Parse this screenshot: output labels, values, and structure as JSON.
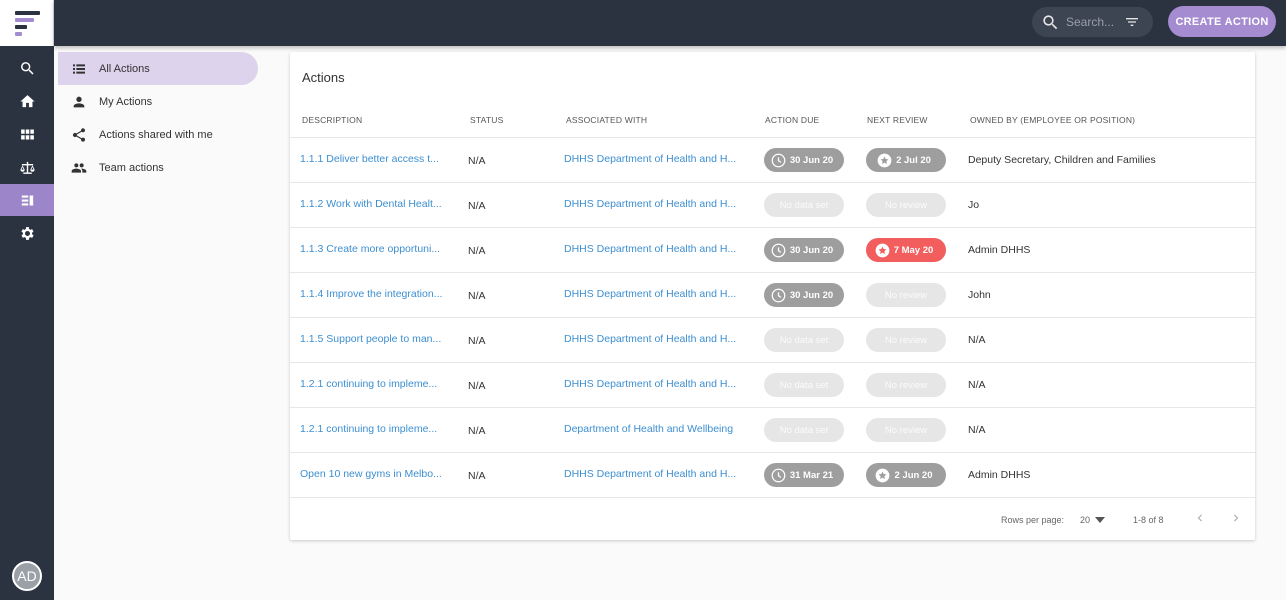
{
  "topbar": {
    "search_placeholder": "Search...",
    "create_label": "CREATE ACTION"
  },
  "rail": {
    "avatar_initials": "AD",
    "items": [
      "search-icon",
      "home-icon",
      "dashboard-icon",
      "balance-scale-icon",
      "actions-icon",
      "settings-icon"
    ],
    "active_index": 4
  },
  "subnav": {
    "items": [
      {
        "label": "All Actions",
        "icon": "list-icon",
        "active": true
      },
      {
        "label": "My Actions",
        "icon": "person-icon",
        "active": false
      },
      {
        "label": "Actions shared with me",
        "icon": "share-icon",
        "active": false
      },
      {
        "label": "Team actions",
        "icon": "people-icon",
        "active": false
      }
    ]
  },
  "table": {
    "title": "Actions",
    "columns": [
      "DESCRIPTION",
      "STATUS",
      "ASSOCIATED WITH",
      "ACTION DUE",
      "NEXT REVIEW",
      "OWNED BY (EMPLOYEE OR POSITION)"
    ],
    "rows": [
      {
        "description": "1.1.1 Deliver better access t...",
        "status": "N/A",
        "associated": "DHHS Department of Health and H...",
        "due": "30 Jun 20",
        "due_state": "set",
        "review": "2 Jul 20",
        "review_state": "set",
        "owner": "Deputy Secretary, Children and Families"
      },
      {
        "description": "1.1.2 Work with Dental Healt...",
        "status": "N/A",
        "associated": "DHHS Department of Health and H...",
        "due": "No data set",
        "due_state": "none",
        "review": "No review",
        "review_state": "none",
        "owner": "Jo"
      },
      {
        "description": "1.1.3 Create more opportuni...",
        "status": "N/A",
        "associated": "DHHS Department of Health and H...",
        "due": "30 Jun 20",
        "due_state": "set",
        "review": "7 May 20",
        "review_state": "overdue",
        "owner": "Admin DHHS"
      },
      {
        "description": "1.1.4 Improve the integration...",
        "status": "N/A",
        "associated": "DHHS Department of Health and H...",
        "due": "30 Jun 20",
        "due_state": "set",
        "review": "No review",
        "review_state": "none",
        "owner": "John"
      },
      {
        "description": "1.1.5 Support people to man...",
        "status": "N/A",
        "associated": "DHHS Department of Health and H...",
        "due": "No data set",
        "due_state": "none",
        "review": "No review",
        "review_state": "none",
        "owner": "N/A"
      },
      {
        "description": "1.2.1 continuing to impleme...",
        "status": "N/A",
        "associated": "DHHS Department of Health and H...",
        "due": "No data set",
        "due_state": "none",
        "review": "No review",
        "review_state": "none",
        "owner": "N/A"
      },
      {
        "description": "1.2.1 continuing to impleme...",
        "status": "N/A",
        "associated": "Department of Health and Wellbeing",
        "due": "No data set",
        "due_state": "none",
        "review": "No review",
        "review_state": "none",
        "owner": "N/A"
      },
      {
        "description": "Open 10 new gyms in Melbo...",
        "status": "N/A",
        "associated": "DHHS Department of Health and H...",
        "due": "31 Mar 21",
        "due_state": "set",
        "review": "2 Jun 20",
        "review_state": "set",
        "owner": "Admin DHHS"
      }
    ]
  },
  "pagination": {
    "rows_per_page_label": "Rows per page:",
    "rows_per_page": "20",
    "range": "1-8 of 8"
  },
  "colors": {
    "topbar": "#2c3340",
    "accent": "#a58bd0",
    "link": "#3d8fd1",
    "chip_set": "#9e9e9e",
    "chip_empty": "#e6e6e6",
    "chip_overdue": "#f25e5e"
  }
}
